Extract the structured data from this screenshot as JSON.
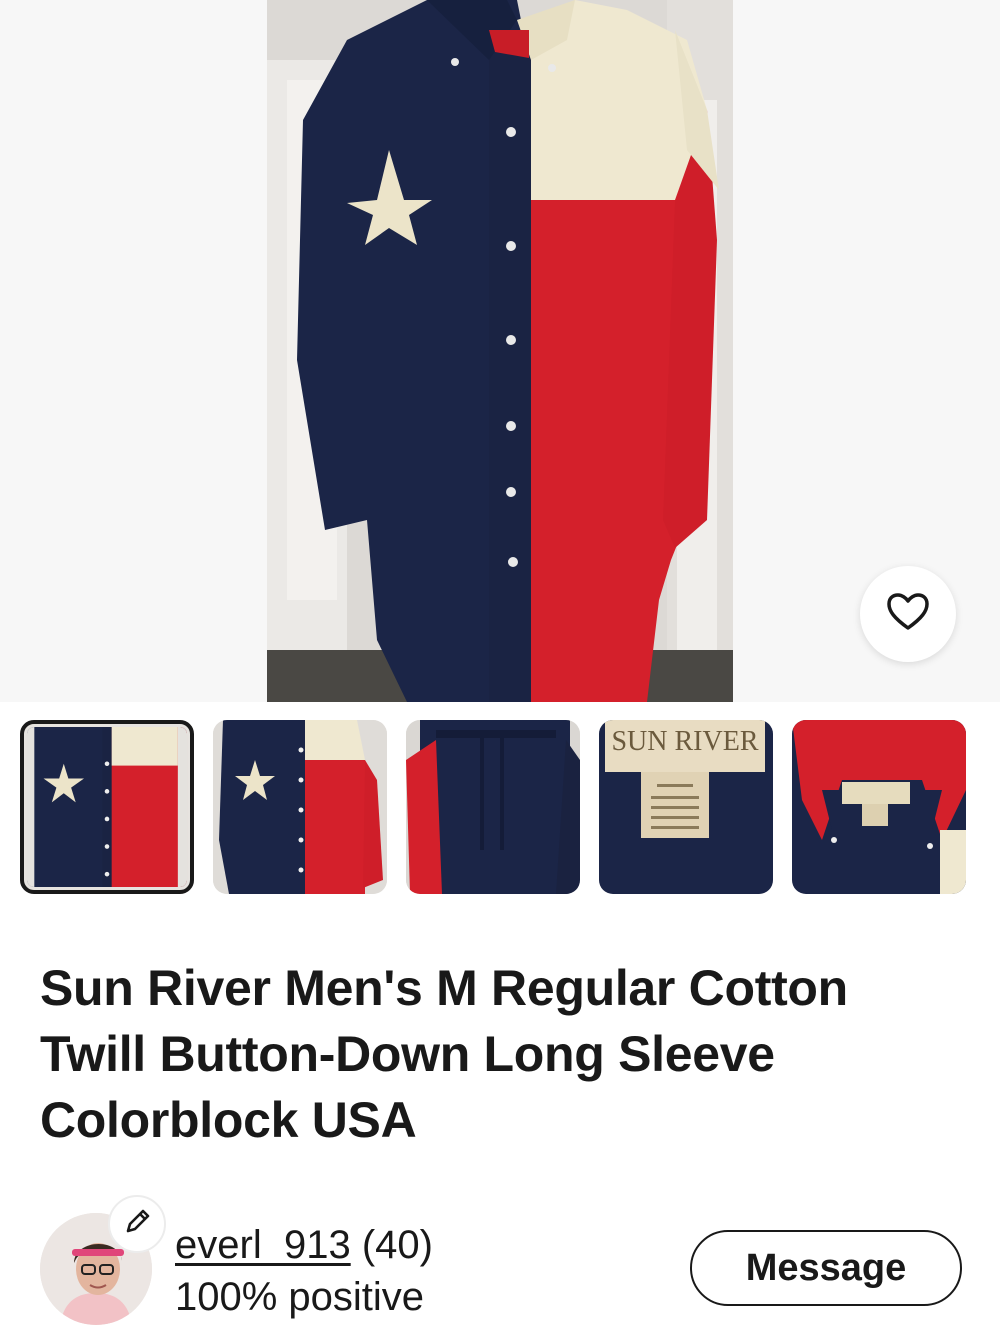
{
  "listing": {
    "title": "Sun River Men's M Regular Cotton Twill Button-Down Long Sleeve Colorblock USA"
  },
  "gallery": {
    "favorite_icon": "heart-icon",
    "selected_index": 0,
    "thumbnails": [
      {
        "alt": "front view texas flag shirt"
      },
      {
        "alt": "front view on hanger"
      },
      {
        "alt": "back view"
      },
      {
        "alt": "sun river label"
      },
      {
        "alt": "collar and label close-up"
      }
    ],
    "label_brand": "SUN RIVER"
  },
  "seller": {
    "name": "everl_913",
    "feedback_count": "(40)",
    "positive": "100% positive",
    "message_label": "Message",
    "edit_icon": "pencil-icon"
  },
  "colors": {
    "navy": "#1b2547",
    "red": "#d4202b",
    "cream": "#efe8d0",
    "text": "#191919"
  }
}
